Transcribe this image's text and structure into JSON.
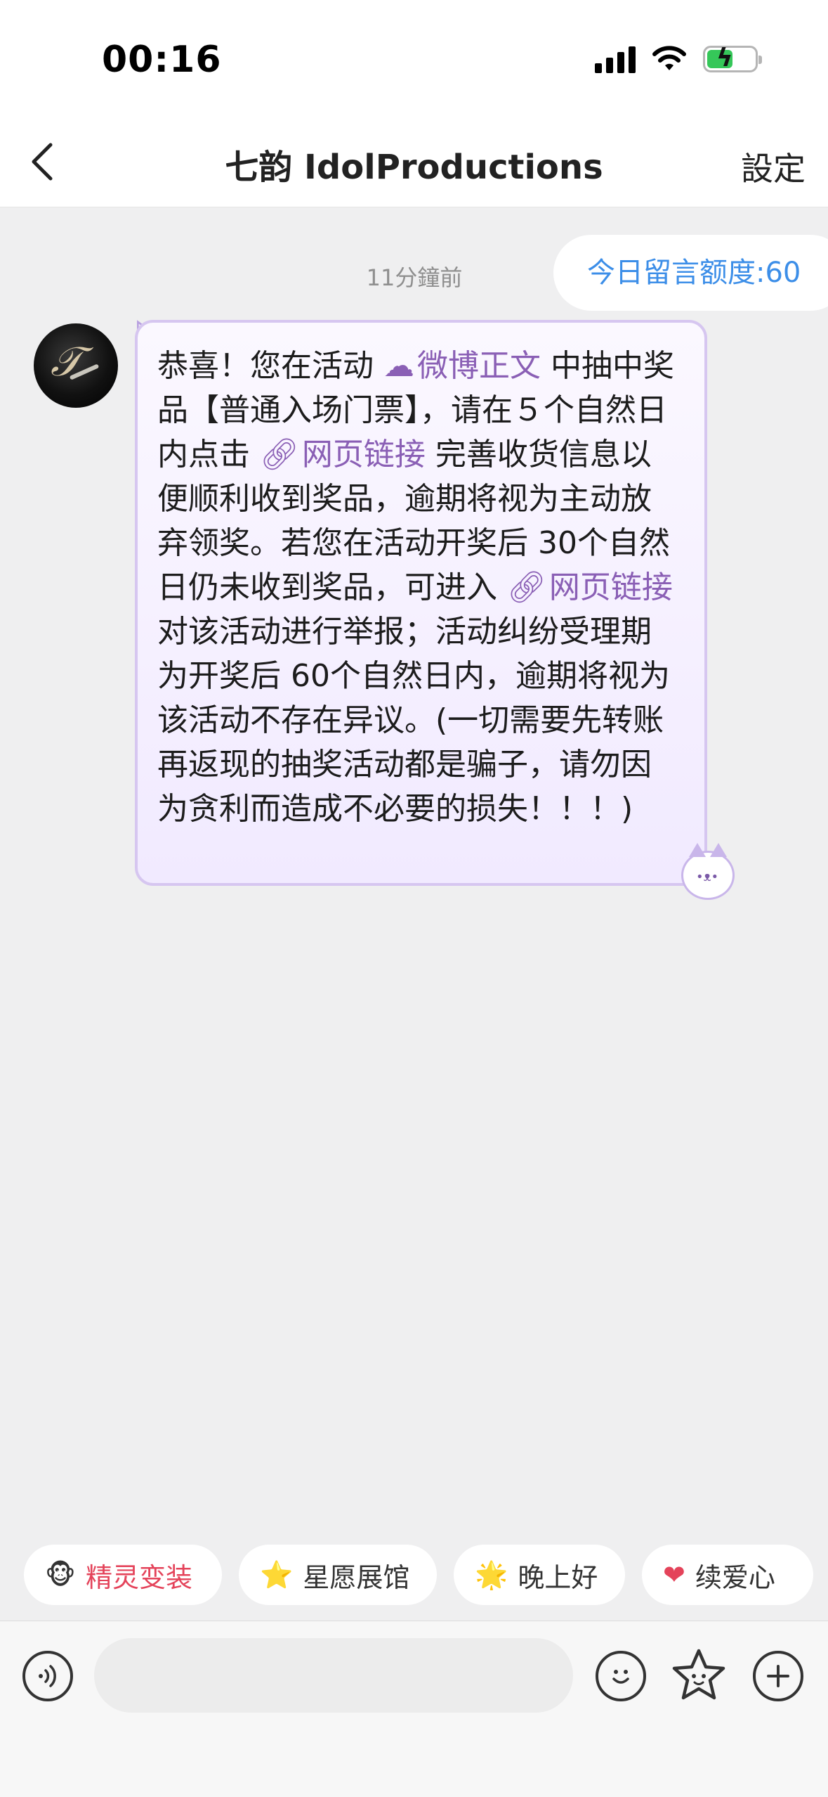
{
  "status_bar": {
    "time": "00:16"
  },
  "nav": {
    "title": "七韵 IdolProductions",
    "settings_label": "設定"
  },
  "chat": {
    "timestamp": "11分鐘前",
    "quota": "今日留言额度:60",
    "message": {
      "part1": "恭喜！您在活动 ",
      "link1_label": "微博正文",
      "part2": " 中抽中奖品【普通入场门票】，请在５个自然日内点击 ",
      "link2_label": "网页链接",
      "part3": " 完善收货信息以便顺利收到奖品，逾期将视为主动放弃领奖。若您在活动开奖后 30个自然日仍未收到奖品，可进入",
      "link3_label": "网页链接",
      "part4": " 对该活动进行举报；活动纠纷受理期为开奖后 60个自然日内，逾期将视为该活动不存在异议。(一切需要先转账再返现的抽奖活动都是骗子，请勿因为贪利而造成不必要的损失！！！)"
    }
  },
  "quick_chips": [
    {
      "label": "精灵变装",
      "icon": "elf-mascot-icon"
    },
    {
      "label": "星愿展馆",
      "icon": "star-icon"
    },
    {
      "label": "晚上好",
      "icon": "star-face-icon"
    },
    {
      "label": "续爱心",
      "icon": "heart-icon"
    }
  ],
  "colors": {
    "link": "#8a5fb5",
    "quota": "#3c8ee8",
    "chip_highlight": "#e4435a",
    "bubble_border": "#d6c6f0"
  }
}
